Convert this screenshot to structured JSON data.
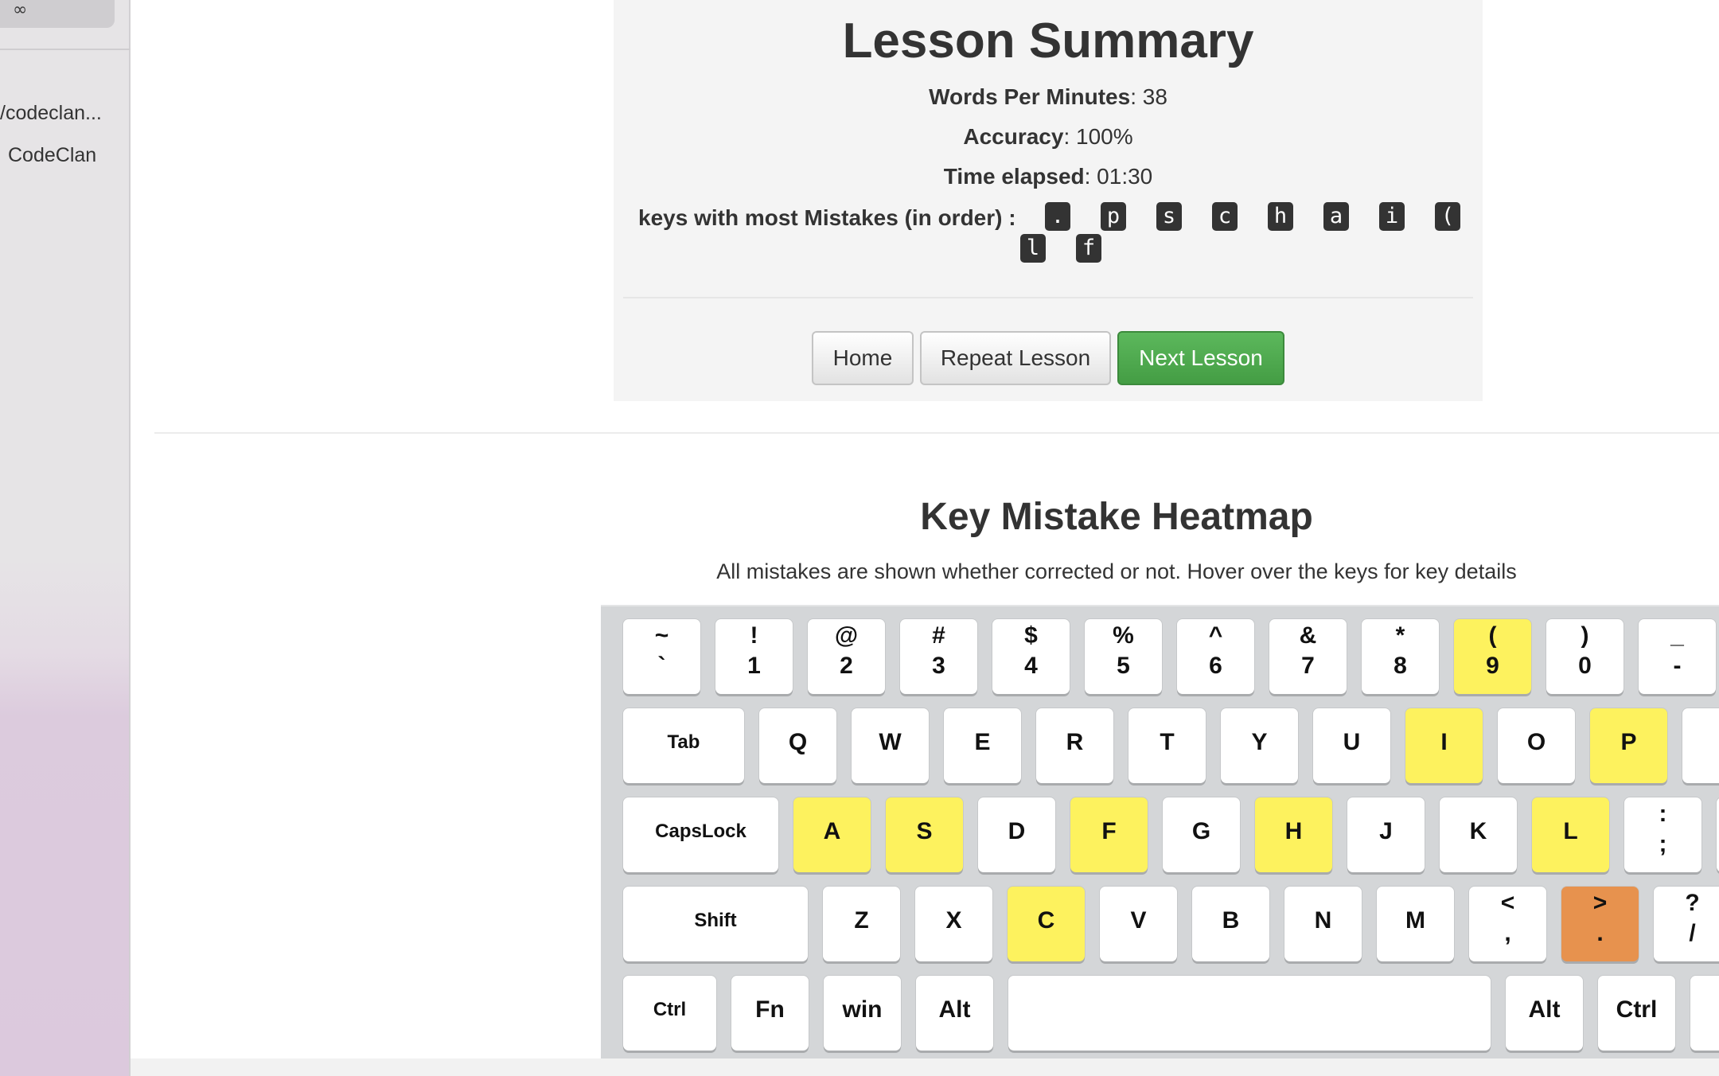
{
  "sidebar": {
    "icon": "glasses-icon",
    "path": "/codeclan...",
    "name": "CodeClan"
  },
  "summary": {
    "title": "Lesson Summary",
    "wpm_label": "Words Per Minutes",
    "wpm_value": ": 38",
    "accuracy_label": "Accuracy",
    "accuracy_value": ": 100%",
    "time_label": "Time elapsed",
    "time_value": ": 01:30",
    "mistakes_label": "keys with most Mistakes (in order) :",
    "mistake_keys": [
      ".",
      "p",
      "s",
      "c",
      "h",
      "a",
      "i",
      "(",
      "l",
      "f"
    ]
  },
  "buttons": {
    "home": "Home",
    "repeat": "Repeat Lesson",
    "next": "Next Lesson"
  },
  "colors": {
    "next_button": "#5cb85c",
    "heat_low": "#fdf25e",
    "heat_high": "#e7924e"
  },
  "heatmap": {
    "title": "Key Mistake Heatmap",
    "subtitle": "All mistakes are shown whether corrected or not. Hover over the keys for key details",
    "rows": [
      [
        {
          "top": "~",
          "bot": "`"
        },
        {
          "top": "!",
          "bot": "1"
        },
        {
          "top": "@",
          "bot": "2"
        },
        {
          "top": "#",
          "bot": "3"
        },
        {
          "top": "$",
          "bot": "4"
        },
        {
          "top": "%",
          "bot": "5"
        },
        {
          "top": "^",
          "bot": "6"
        },
        {
          "top": "&",
          "bot": "7"
        },
        {
          "top": "*",
          "bot": "8"
        },
        {
          "top": "(",
          "bot": "9",
          "heat": "y"
        },
        {
          "top": ")",
          "bot": "0"
        },
        {
          "top": "_",
          "bot": "-"
        }
      ],
      [
        {
          "label": "Tab",
          "small": true
        },
        {
          "label": "Q"
        },
        {
          "label": "W"
        },
        {
          "label": "E"
        },
        {
          "label": "R"
        },
        {
          "label": "T"
        },
        {
          "label": "Y"
        },
        {
          "label": "U"
        },
        {
          "label": "I",
          "heat": "y"
        },
        {
          "label": "O"
        },
        {
          "label": "P",
          "heat": "y"
        },
        {
          "label": ""
        }
      ],
      [
        {
          "label": "CapsLock",
          "small": true
        },
        {
          "label": "A",
          "heat": "y"
        },
        {
          "label": "S",
          "heat": "y"
        },
        {
          "label": "D"
        },
        {
          "label": "F",
          "heat": "y"
        },
        {
          "label": "G"
        },
        {
          "label": "H",
          "heat": "y"
        },
        {
          "label": "J"
        },
        {
          "label": "K"
        },
        {
          "label": "L",
          "heat": "y"
        },
        {
          "top": ":",
          "bot": ";"
        },
        {
          "label": ""
        }
      ],
      [
        {
          "label": "Shift",
          "small": true
        },
        {
          "label": "Z"
        },
        {
          "label": "X"
        },
        {
          "label": "C",
          "heat": "y"
        },
        {
          "label": "V"
        },
        {
          "label": "B"
        },
        {
          "label": "N"
        },
        {
          "label": "M"
        },
        {
          "top": "<",
          "bot": ","
        },
        {
          "top": ">",
          "bot": ".",
          "heat": "o"
        },
        {
          "top": "?",
          "bot": "/"
        }
      ],
      [
        {
          "label": "Ctrl",
          "small": true
        },
        {
          "label": "Fn"
        },
        {
          "label": "win"
        },
        {
          "label": "Alt"
        },
        {
          "label": ""
        },
        {
          "label": "Alt"
        },
        {
          "label": "Ctrl"
        },
        {
          "label": ""
        }
      ]
    ]
  }
}
